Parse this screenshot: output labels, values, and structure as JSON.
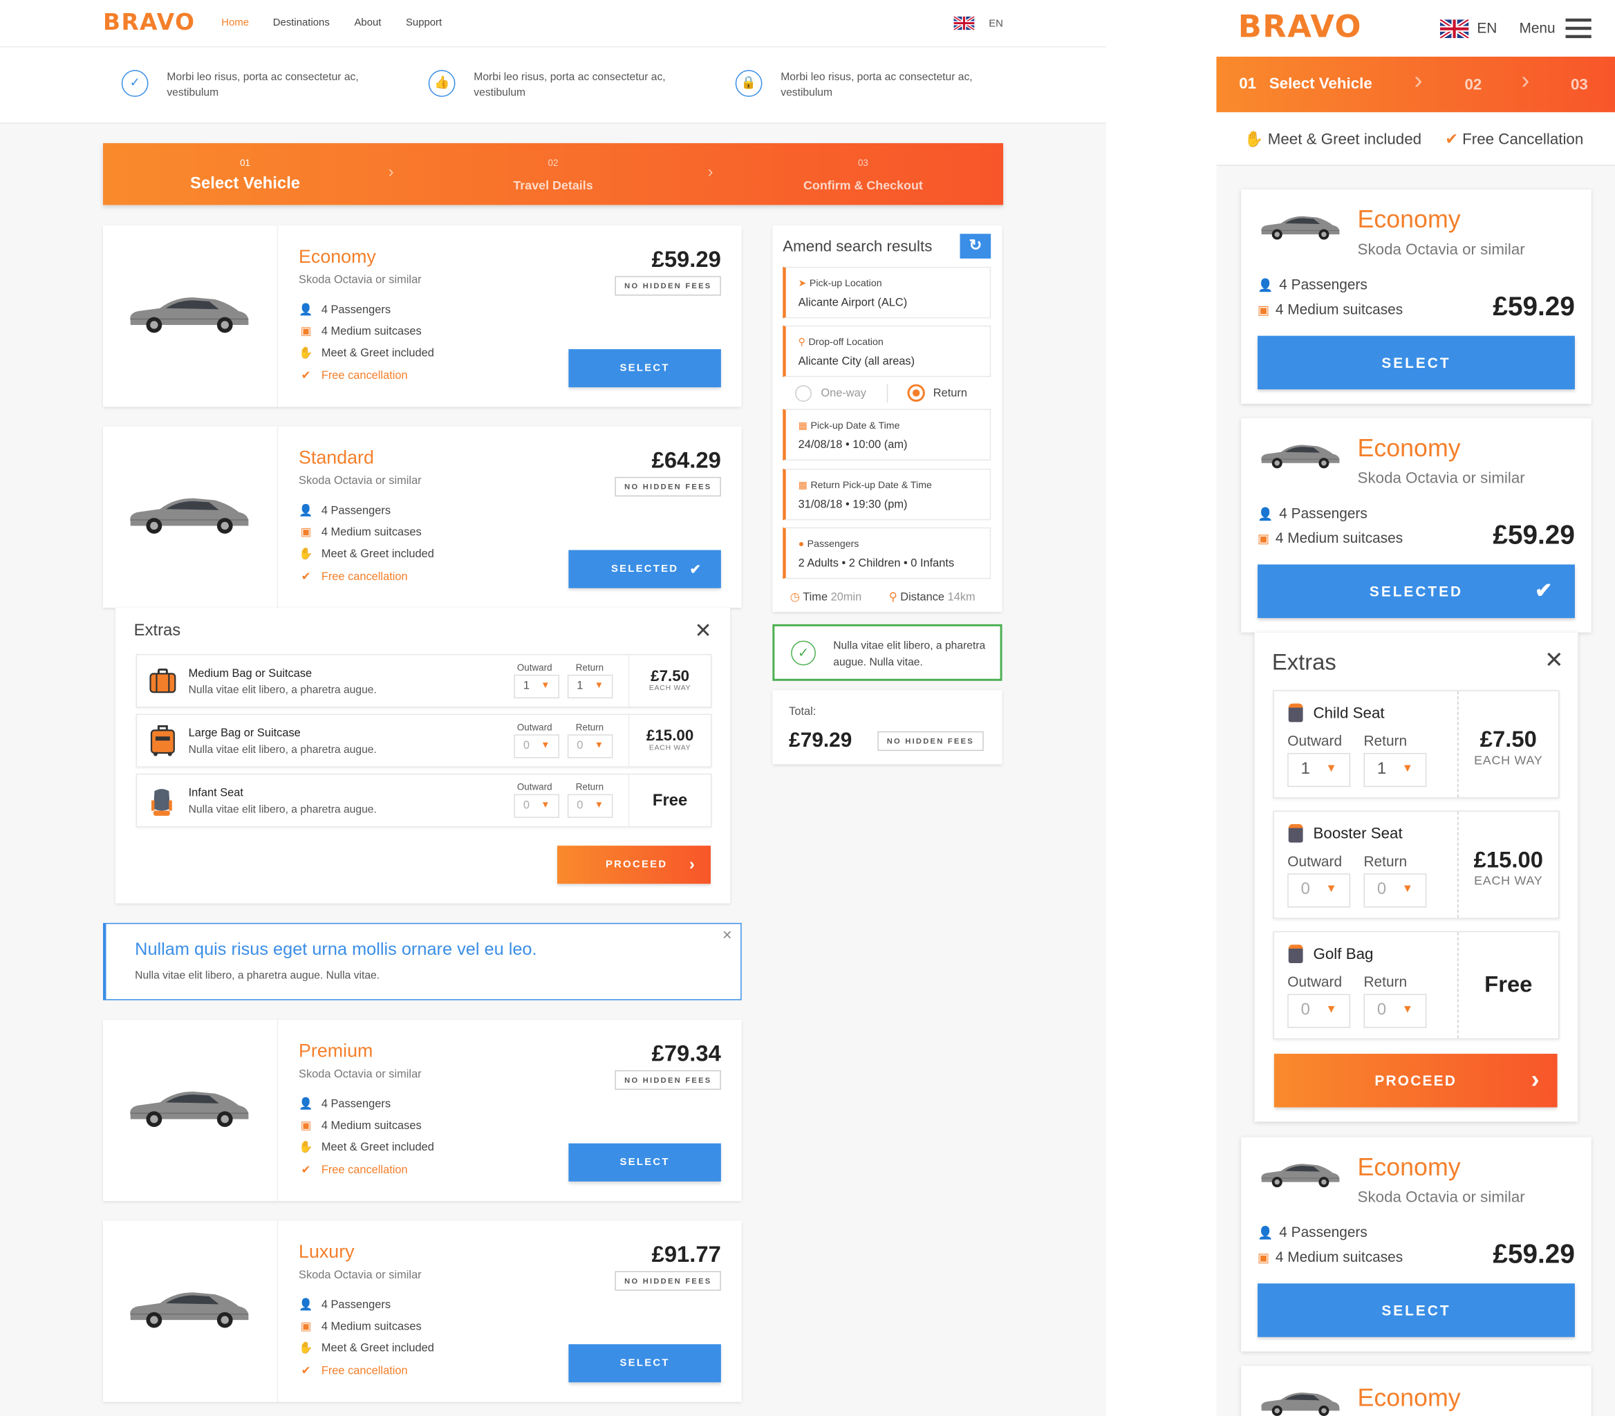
{
  "desktop": {
    "brand": "BRAVO",
    "nav": [
      "Home",
      "Destinations",
      "About",
      "Support"
    ],
    "language": "EN",
    "usps": [
      {
        "icon": "check-circle-icon",
        "text": "Morbi leo risus, porta ac consectetur ac, vestibulum"
      },
      {
        "icon": "thumbs-up-icon",
        "text": "Morbi leo risus, porta ac consectetur ac, vestibulum"
      },
      {
        "icon": "lock-icon",
        "text": "Morbi leo risus, porta ac consectetur ac, vestibulum"
      }
    ],
    "steps": [
      {
        "num": "01",
        "label": "Select Vehicle",
        "active": true
      },
      {
        "num": "02",
        "label": "Travel Details",
        "active": false
      },
      {
        "num": "03",
        "label": "Confirm & Checkout",
        "active": false
      }
    ],
    "vehicles": [
      {
        "class": "Economy",
        "similar": "Skoda Octavia or similar",
        "price": "£59.29",
        "passengers": "4 Passengers",
        "suitcases": "4 Medium suitcases",
        "meet": "Meet & Greet included",
        "cancel": "Free cancellation",
        "fees": "NO HIDDEN FEES",
        "button": "SELECT"
      },
      {
        "class": "Standard",
        "similar": "Skoda Octavia or similar",
        "price": "£64.29",
        "passengers": "4 Passengers",
        "suitcases": "4 Medium suitcases",
        "meet": "Meet & Greet included",
        "cancel": "Free cancellation",
        "fees": "NO HIDDEN FEES",
        "button": "SELECTED"
      },
      {
        "class": "Premium",
        "similar": "Skoda Octavia or similar",
        "price": "£79.34",
        "passengers": "4 Passengers",
        "suitcases": "4 Medium suitcases",
        "meet": "Meet & Greet included",
        "cancel": "Free cancellation",
        "fees": "NO HIDDEN FEES",
        "button": "SELECT"
      },
      {
        "class": "Luxury",
        "similar": "Skoda Octavia or similar",
        "price": "£91.77",
        "passengers": "4 Passengers",
        "suitcases": "4 Medium suitcases",
        "meet": "Meet & Greet included",
        "cancel": "Free cancellation",
        "fees": "NO HIDDEN FEES",
        "button": "SELECT"
      }
    ],
    "extras": {
      "title": "Extras",
      "outward_label": "Outward",
      "return_label": "Return",
      "items": [
        {
          "name": "Medium Bag or Suitcase",
          "desc": "Nulla vitae elit libero, a pharetra augue.",
          "outward": "1",
          "return": "1",
          "price": "£7.50",
          "unit": "EACH WAY"
        },
        {
          "name": "Large Bag or Suitcase",
          "desc": "Nulla vitae elit libero, a pharetra augue.",
          "outward": "0",
          "return": "0",
          "price": "£15.00",
          "unit": "EACH WAY"
        },
        {
          "name": "Infant Seat",
          "desc": "Nulla vitae elit libero, a pharetra augue.",
          "outward": "0",
          "return": "0",
          "price": "Free",
          "unit": ""
        }
      ],
      "proceed": "PROCEED"
    },
    "alert": {
      "title": "Nullam quis risus eget urna mollis ornare vel eu leo.",
      "text": "Nulla vitae elit libero, a pharetra augue. Nulla vitae."
    },
    "amend": {
      "title": "Amend search results",
      "pickup_label": "Pick-up Location",
      "pickup": "Alicante Airport (ALC)",
      "dropoff_label": "Drop-off Location",
      "dropoff": "Alicante City (all areas)",
      "oneway": "One-way",
      "return": "Return",
      "trip_type": "Return",
      "pickup_dt_label": "Pick-up Date & Time",
      "pickup_dt": "24/08/18  •  10:00 (am)",
      "return_dt_label": "Return Pick-up Date & Time",
      "return_dt": "31/08/18  •  19:30 (pm)",
      "pax_label": "Passengers",
      "pax": "2 Adults  •  2 Children  •  0 Infants",
      "time_label": "Time",
      "time": "20min",
      "distance_label": "Distance",
      "distance": "14km"
    },
    "success": {
      "text": "Nulla vitae elit libero, a pharetra augue. Nulla vitae."
    },
    "total": {
      "label": "Total:",
      "amount": "£79.29",
      "fees": "NO HIDDEN FEES"
    }
  },
  "mobile": {
    "brand": "BRAVO",
    "language": "EN",
    "menu": "Menu",
    "steps": [
      {
        "num": "01",
        "label": "Select Vehicle"
      },
      {
        "num": "02"
      },
      {
        "num": "03"
      }
    ],
    "badges": [
      "Meet & Greet included",
      "Free Cancellation"
    ],
    "vehicles": [
      {
        "class": "Economy",
        "similar": "Skoda Octavia or similar",
        "passengers": "4 Passengers",
        "suitcases": "4 Medium suitcases",
        "price": "£59.29",
        "button": "SELECT"
      },
      {
        "class": "Economy",
        "similar": "Skoda Octavia or similar",
        "passengers": "4 Passengers",
        "suitcases": "4 Medium suitcases",
        "price": "£59.29",
        "button": "SELECTED"
      },
      {
        "class": "Economy",
        "similar": "Skoda Octavia or similar",
        "passengers": "4 Passengers",
        "suitcases": "4 Medium suitcases",
        "price": "£59.29",
        "button": "SELECT"
      },
      {
        "class": "Economy"
      }
    ],
    "extras": {
      "title": "Extras",
      "outward_label": "Outward",
      "return_label": "Return",
      "items": [
        {
          "name": "Child Seat",
          "outward": "1",
          "return": "1",
          "price": "£7.50",
          "unit": "EACH WAY"
        },
        {
          "name": "Booster Seat",
          "outward": "0",
          "return": "0",
          "price": "£15.00",
          "unit": "EACH WAY"
        },
        {
          "name": "Golf Bag",
          "outward": "0",
          "return": "0",
          "price": "Free",
          "unit": ""
        }
      ],
      "proceed": "PROCEED"
    }
  },
  "colors": {
    "brand_orange": "#f47f2a",
    "primary_blue": "#3a8ee6",
    "success_green": "#4caf50"
  }
}
